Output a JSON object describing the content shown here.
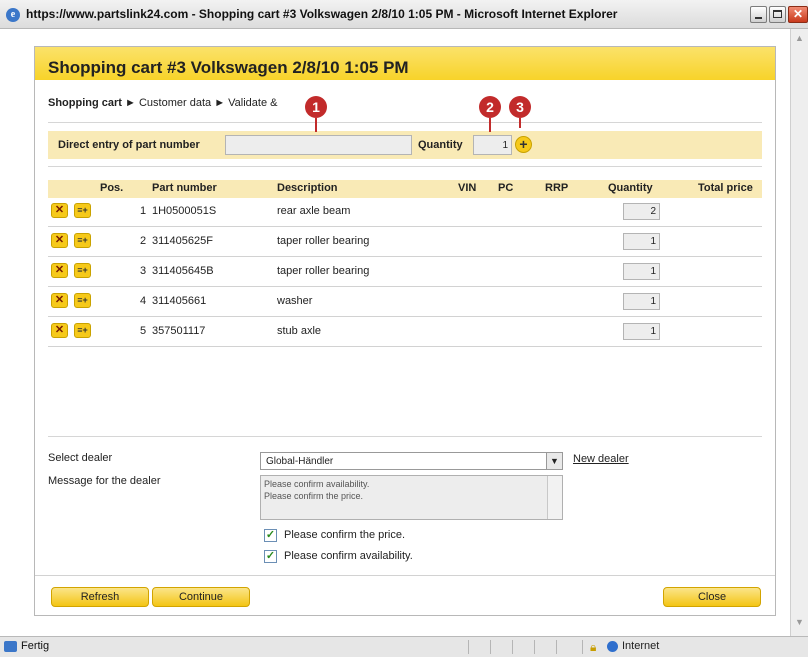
{
  "window": {
    "title": "https://www.partslink24.com - Shopping cart #3 Volkswagen 2/8/10 1:05 PM - Microsoft Internet Explorer",
    "icon": "ie-logo-icon"
  },
  "status_bar": {
    "text": "Fertig",
    "zone": "Internet"
  },
  "dialog": {
    "title": "Shopping cart #3 Volkswagen 2/8/10 1:05 PM",
    "breadcrumb": {
      "current": "Shopping cart",
      "step2": "Customer data",
      "step3": "Validate & "
    },
    "direct_entry": {
      "label": "Direct entry of part number",
      "part_value": "",
      "quantity_label": "Quantity",
      "quantity_value": "1"
    },
    "callouts": [
      "1",
      "2",
      "3"
    ],
    "table": {
      "headers": {
        "pos": "Pos.",
        "part_number": "Part number",
        "description": "Description",
        "vin": "VIN",
        "pc": "PC",
        "rrp": "RRP",
        "quantity": "Quantity",
        "total_price": "Total price"
      },
      "rows": [
        {
          "pos": "1",
          "part_number": "1H0500051S",
          "description": "rear axle beam",
          "quantity": "2"
        },
        {
          "pos": "2",
          "part_number": "311405625F",
          "description": "taper roller bearing",
          "quantity": "1"
        },
        {
          "pos": "3",
          "part_number": "311405645B",
          "description": "taper roller bearing",
          "quantity": "1"
        },
        {
          "pos": "4",
          "part_number": "311405661",
          "description": "washer",
          "quantity": "1"
        },
        {
          "pos": "5",
          "part_number": "357501117",
          "description": "stub axle",
          "quantity": "1"
        }
      ]
    },
    "dealer": {
      "select_label": "Select dealer",
      "selected": "Global-Händler",
      "new_dealer": "New dealer",
      "message_label": "Message for the dealer",
      "message_line1": "Please confirm availability.",
      "message_line2": "Please confirm the price.",
      "check_price": "Please confirm the price.",
      "check_availability": "Please confirm availability."
    },
    "buttons": {
      "refresh": "Refresh",
      "continue": "Continue",
      "close": "Close"
    }
  },
  "colors": {
    "accent_yellow": "#f6cd10",
    "band_yellow": "#f9eab6",
    "callout_red": "#c22b2b"
  }
}
